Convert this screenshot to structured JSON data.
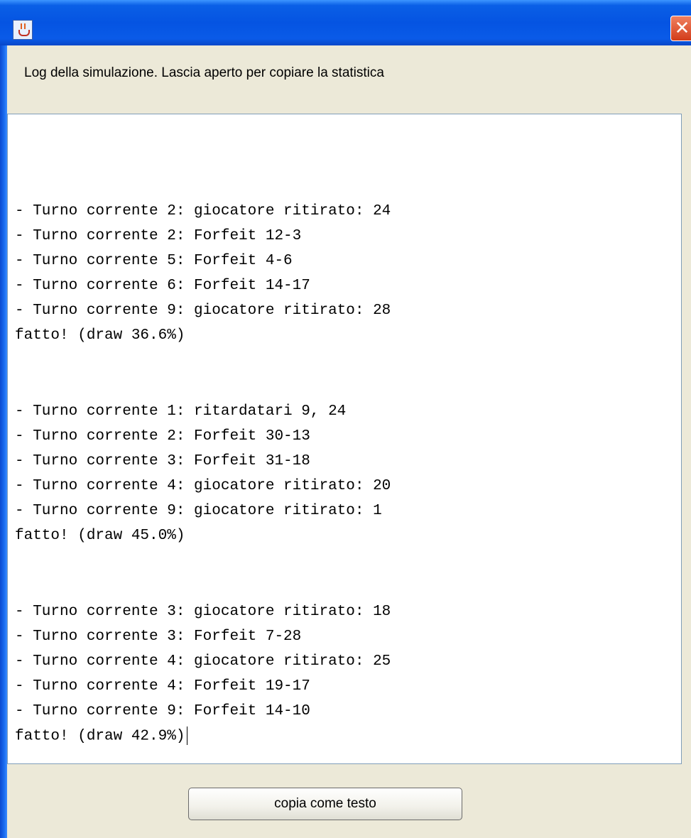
{
  "window": {
    "title": "",
    "close_glyph": "✕",
    "header_text": "Log della simulazione. Lascia aperto per copiare la statistica"
  },
  "log": {
    "lines": [
      "- Turno corrente 2: giocatore ritirato: 24",
      "- Turno corrente 2: Forfeit 12-3",
      "- Turno corrente 5: Forfeit 4-6",
      "- Turno corrente 6: Forfeit 14-17",
      "- Turno corrente 9: giocatore ritirato: 28",
      "fatto! (draw 36.6%)",
      "- Turno corrente 1: ritardatari 9, 24",
      "- Turno corrente 2: Forfeit 30-13",
      "- Turno corrente 3: Forfeit 31-18",
      "- Turno corrente 4: giocatore ritirato: 20",
      "- Turno corrente 9: giocatore ritirato: 1",
      "fatto! (draw 45.0%)",
      "- Turno corrente 3: giocatore ritirato: 18",
      "- Turno corrente 3: Forfeit 7-28",
      "- Turno corrente 4: giocatore ritirato: 25",
      "- Turno corrente 4: Forfeit 19-17",
      "- Turno corrente 9: Forfeit 14-10",
      "fatto! (draw 42.9%)"
    ]
  },
  "buttons": {
    "copy_label": "copia come testo"
  },
  "icons": {
    "app": "java-coffee-cup-icon",
    "close": "close-icon"
  },
  "colors": {
    "titlebar": "#0554e2",
    "close_button": "#d23c1a",
    "window_bg": "#ece9d8",
    "text_area_bg": "#ffffff"
  }
}
